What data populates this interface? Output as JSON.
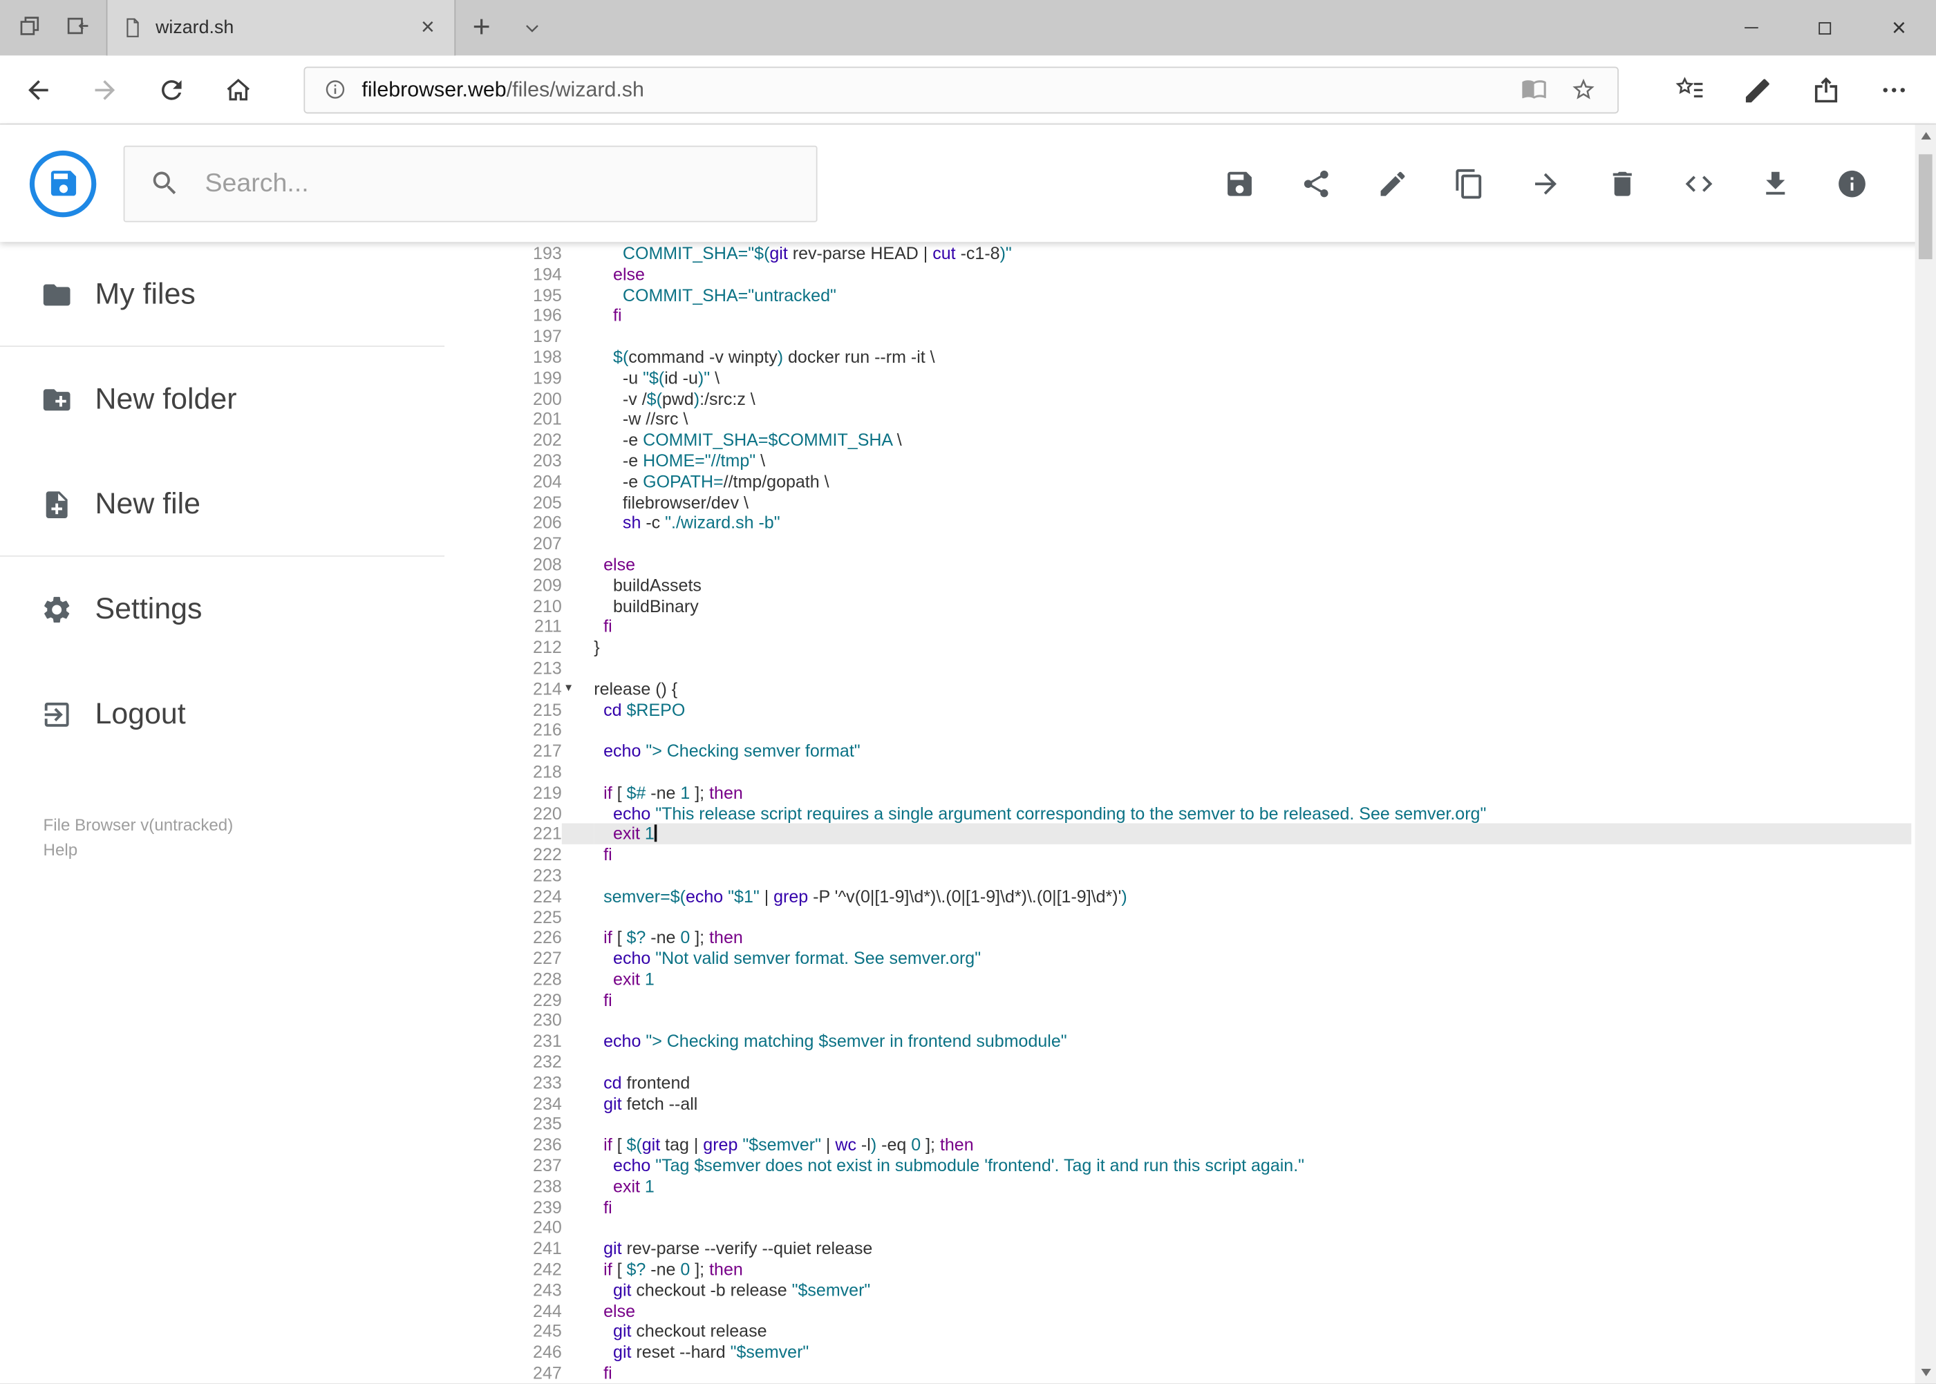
{
  "browser": {
    "tab_title": "wizard.sh",
    "url_domain": "filebrowser.web",
    "url_path": "/files/wizard.sh",
    "tab_icons": [
      "tabs-set-aside",
      "set-tabs-aside",
      "page",
      "tab-close",
      "new-tab",
      "tab-preview-chevron"
    ],
    "nav_icons": [
      "back",
      "forward",
      "refresh",
      "home"
    ],
    "address_icons": [
      "site-info",
      "reading-view",
      "favorite-star"
    ],
    "action_icons": [
      "hub",
      "web-note",
      "share",
      "more"
    ],
    "window_icons": [
      "minimize",
      "maximize",
      "close"
    ]
  },
  "header": {
    "search_placeholder": "Search...",
    "toolbar": [
      {
        "id": "save",
        "icon": "save"
      },
      {
        "id": "share",
        "icon": "share"
      },
      {
        "id": "edit",
        "icon": "pencil"
      },
      {
        "id": "copy",
        "icon": "copy"
      },
      {
        "id": "move",
        "icon": "move"
      },
      {
        "id": "delete",
        "icon": "trash"
      },
      {
        "id": "code",
        "icon": "code"
      },
      {
        "id": "download",
        "icon": "download"
      },
      {
        "id": "info",
        "icon": "info"
      }
    ]
  },
  "sidebar": {
    "items": [
      {
        "id": "my-files",
        "label": "My files",
        "icon": "folder",
        "divider_after": true
      },
      {
        "id": "new-folder",
        "label": "New folder",
        "icon": "folder-plus",
        "divider_after": false
      },
      {
        "id": "new-file",
        "label": "New file",
        "icon": "file-plus",
        "divider_after": true
      },
      {
        "id": "settings",
        "label": "Settings",
        "icon": "gear",
        "divider_after": false
      },
      {
        "id": "logout",
        "label": "Logout",
        "icon": "logout",
        "divider_after": false
      }
    ],
    "footer_version": "File Browser v(untracked)",
    "footer_help": "Help"
  },
  "editor": {
    "active_line": 221,
    "cursor_line": 221,
    "fold_lines": [
      214
    ],
    "palette": {
      "p": "#333333",
      "k": "#770088",
      "b": "#3300aa",
      "s": "#0b7285",
      "v": "#0b7285",
      "n": "#0b7285"
    },
    "lines": [
      {
        "n": 193,
        "s": [
          [
            "p",
            "      "
          ],
          [
            "v",
            "COMMIT_SHA="
          ],
          [
            "s",
            "\"$("
          ],
          [
            "b",
            "git"
          ],
          [
            "p",
            " rev-parse HEAD | "
          ],
          [
            "b",
            "cut"
          ],
          [
            "p",
            " -c1-8"
          ],
          [
            "s",
            ")\""
          ]
        ]
      },
      {
        "n": 194,
        "s": [
          [
            "p",
            "    "
          ],
          [
            "k",
            "else"
          ]
        ]
      },
      {
        "n": 195,
        "s": [
          [
            "p",
            "      "
          ],
          [
            "v",
            "COMMIT_SHA="
          ],
          [
            "s",
            "\"untracked\""
          ]
        ]
      },
      {
        "n": 196,
        "s": [
          [
            "p",
            "    "
          ],
          [
            "k",
            "fi"
          ]
        ]
      },
      {
        "n": 197,
        "s": []
      },
      {
        "n": 198,
        "s": [
          [
            "p",
            "    "
          ],
          [
            "v",
            "$("
          ],
          [
            "p",
            "command -v winpty"
          ],
          [
            "v",
            ")"
          ],
          [
            "p",
            " docker run --rm -it \\"
          ]
        ]
      },
      {
        "n": 199,
        "s": [
          [
            "p",
            "      -u "
          ],
          [
            "s",
            "\"$("
          ],
          [
            "p",
            "id -u"
          ],
          [
            "s",
            ")\""
          ],
          [
            "p",
            " \\"
          ]
        ]
      },
      {
        "n": 200,
        "s": [
          [
            "p",
            "      -v /"
          ],
          [
            "v",
            "$("
          ],
          [
            "p",
            "pwd"
          ],
          [
            "v",
            ")"
          ],
          [
            "p",
            ":/src:z \\"
          ]
        ]
      },
      {
        "n": 201,
        "s": [
          [
            "p",
            "      -w //src \\"
          ]
        ]
      },
      {
        "n": 202,
        "s": [
          [
            "p",
            "      -e "
          ],
          [
            "v",
            "COMMIT_SHA=$COMMIT_SHA"
          ],
          [
            "p",
            " \\"
          ]
        ]
      },
      {
        "n": 203,
        "s": [
          [
            "p",
            "      -e "
          ],
          [
            "v",
            "HOME="
          ],
          [
            "s",
            "\"//tmp\""
          ],
          [
            "p",
            " \\"
          ]
        ]
      },
      {
        "n": 204,
        "s": [
          [
            "p",
            "      -e "
          ],
          [
            "v",
            "GOPATH="
          ],
          [
            "p",
            "//tmp/gopath \\"
          ]
        ]
      },
      {
        "n": 205,
        "s": [
          [
            "p",
            "      filebrowser/dev \\"
          ]
        ]
      },
      {
        "n": 206,
        "s": [
          [
            "p",
            "      "
          ],
          [
            "b",
            "sh"
          ],
          [
            "p",
            " -c "
          ],
          [
            "s",
            "\"./wizard.sh -b\""
          ]
        ]
      },
      {
        "n": 207,
        "s": []
      },
      {
        "n": 208,
        "s": [
          [
            "p",
            "  "
          ],
          [
            "k",
            "else"
          ]
        ]
      },
      {
        "n": 209,
        "s": [
          [
            "p",
            "    buildAssets"
          ]
        ]
      },
      {
        "n": 210,
        "s": [
          [
            "p",
            "    buildBinary"
          ]
        ]
      },
      {
        "n": 211,
        "s": [
          [
            "p",
            "  "
          ],
          [
            "k",
            "fi"
          ]
        ]
      },
      {
        "n": 212,
        "s": [
          [
            "p",
            "}"
          ]
        ]
      },
      {
        "n": 213,
        "s": []
      },
      {
        "n": 214,
        "s": [
          [
            "p",
            "release () {"
          ]
        ]
      },
      {
        "n": 215,
        "s": [
          [
            "p",
            "  "
          ],
          [
            "b",
            "cd"
          ],
          [
            "p",
            " "
          ],
          [
            "v",
            "$REPO"
          ]
        ]
      },
      {
        "n": 216,
        "s": []
      },
      {
        "n": 217,
        "s": [
          [
            "p",
            "  "
          ],
          [
            "b",
            "echo"
          ],
          [
            "p",
            " "
          ],
          [
            "s",
            "\"> Checking semver format\""
          ]
        ]
      },
      {
        "n": 218,
        "s": []
      },
      {
        "n": 219,
        "s": [
          [
            "p",
            "  "
          ],
          [
            "k",
            "if"
          ],
          [
            "p",
            " [ "
          ],
          [
            "v",
            "$#"
          ],
          [
            "p",
            " -ne "
          ],
          [
            "n",
            "1"
          ],
          [
            "p",
            " ]; "
          ],
          [
            "k",
            "then"
          ]
        ]
      },
      {
        "n": 220,
        "s": [
          [
            "p",
            "    "
          ],
          [
            "b",
            "echo"
          ],
          [
            "p",
            " "
          ],
          [
            "s",
            "\"This release script requires a single argument corresponding to the semver to be released. See semver.org\""
          ]
        ]
      },
      {
        "n": 221,
        "s": [
          [
            "p",
            "    "
          ],
          [
            "k",
            "exit"
          ],
          [
            "p",
            " "
          ],
          [
            "n",
            "1"
          ]
        ]
      },
      {
        "n": 222,
        "s": [
          [
            "p",
            "  "
          ],
          [
            "k",
            "fi"
          ]
        ]
      },
      {
        "n": 223,
        "s": []
      },
      {
        "n": 224,
        "s": [
          [
            "p",
            "  "
          ],
          [
            "v",
            "semver=$("
          ],
          [
            "b",
            "echo"
          ],
          [
            "p",
            " "
          ],
          [
            "s",
            "\"$1\""
          ],
          [
            "p",
            " | "
          ],
          [
            "b",
            "grep"
          ],
          [
            "p",
            " -P '^v(0|[1-9]\\d*)\\.(0|[1-9]\\d*)\\.(0|[1-9]\\d*)'"
          ],
          [
            "v",
            ")"
          ]
        ]
      },
      {
        "n": 225,
        "s": []
      },
      {
        "n": 226,
        "s": [
          [
            "p",
            "  "
          ],
          [
            "k",
            "if"
          ],
          [
            "p",
            " [ "
          ],
          [
            "v",
            "$?"
          ],
          [
            "p",
            " -ne "
          ],
          [
            "n",
            "0"
          ],
          [
            "p",
            " ]; "
          ],
          [
            "k",
            "then"
          ]
        ]
      },
      {
        "n": 227,
        "s": [
          [
            "p",
            "    "
          ],
          [
            "b",
            "echo"
          ],
          [
            "p",
            " "
          ],
          [
            "s",
            "\"Not valid semver format. See semver.org\""
          ]
        ]
      },
      {
        "n": 228,
        "s": [
          [
            "p",
            "    "
          ],
          [
            "k",
            "exit"
          ],
          [
            "p",
            " "
          ],
          [
            "n",
            "1"
          ]
        ]
      },
      {
        "n": 229,
        "s": [
          [
            "p",
            "  "
          ],
          [
            "k",
            "fi"
          ]
        ]
      },
      {
        "n": 230,
        "s": []
      },
      {
        "n": 231,
        "s": [
          [
            "p",
            "  "
          ],
          [
            "b",
            "echo"
          ],
          [
            "p",
            " "
          ],
          [
            "s",
            "\"> Checking matching "
          ],
          [
            "v",
            "$semver"
          ],
          [
            "s",
            " in frontend submodule\""
          ]
        ]
      },
      {
        "n": 232,
        "s": []
      },
      {
        "n": 233,
        "s": [
          [
            "p",
            "  "
          ],
          [
            "b",
            "cd"
          ],
          [
            "p",
            " frontend"
          ]
        ]
      },
      {
        "n": 234,
        "s": [
          [
            "p",
            "  "
          ],
          [
            "b",
            "git"
          ],
          [
            "p",
            " fetch --all"
          ]
        ]
      },
      {
        "n": 235,
        "s": []
      },
      {
        "n": 236,
        "s": [
          [
            "p",
            "  "
          ],
          [
            "k",
            "if"
          ],
          [
            "p",
            " [ "
          ],
          [
            "v",
            "$("
          ],
          [
            "b",
            "git"
          ],
          [
            "p",
            " tag | "
          ],
          [
            "b",
            "grep"
          ],
          [
            "p",
            " "
          ],
          [
            "s",
            "\"$semver\""
          ],
          [
            "p",
            " | "
          ],
          [
            "b",
            "wc"
          ],
          [
            "p",
            " -l"
          ],
          [
            "v",
            ")"
          ],
          [
            "p",
            " -eq "
          ],
          [
            "n",
            "0"
          ],
          [
            "p",
            " ]; "
          ],
          [
            "k",
            "then"
          ]
        ]
      },
      {
        "n": 237,
        "s": [
          [
            "p",
            "    "
          ],
          [
            "b",
            "echo"
          ],
          [
            "p",
            " "
          ],
          [
            "s",
            "\"Tag "
          ],
          [
            "v",
            "$semver"
          ],
          [
            "s",
            " does not exist in submodule 'frontend'. Tag it and run this script again.\""
          ]
        ]
      },
      {
        "n": 238,
        "s": [
          [
            "p",
            "    "
          ],
          [
            "k",
            "exit"
          ],
          [
            "p",
            " "
          ],
          [
            "n",
            "1"
          ]
        ]
      },
      {
        "n": 239,
        "s": [
          [
            "p",
            "  "
          ],
          [
            "k",
            "fi"
          ]
        ]
      },
      {
        "n": 240,
        "s": []
      },
      {
        "n": 241,
        "s": [
          [
            "p",
            "  "
          ],
          [
            "b",
            "git"
          ],
          [
            "p",
            " rev-parse --verify --quiet release"
          ]
        ]
      },
      {
        "n": 242,
        "s": [
          [
            "p",
            "  "
          ],
          [
            "k",
            "if"
          ],
          [
            "p",
            " [ "
          ],
          [
            "v",
            "$?"
          ],
          [
            "p",
            " -ne "
          ],
          [
            "n",
            "0"
          ],
          [
            "p",
            " ]; "
          ],
          [
            "k",
            "then"
          ]
        ]
      },
      {
        "n": 243,
        "s": [
          [
            "p",
            "    "
          ],
          [
            "b",
            "git"
          ],
          [
            "p",
            " checkout -b release "
          ],
          [
            "s",
            "\"$semver\""
          ]
        ]
      },
      {
        "n": 244,
        "s": [
          [
            "p",
            "  "
          ],
          [
            "k",
            "else"
          ]
        ]
      },
      {
        "n": 245,
        "s": [
          [
            "p",
            "    "
          ],
          [
            "b",
            "git"
          ],
          [
            "p",
            " checkout release"
          ]
        ]
      },
      {
        "n": 246,
        "s": [
          [
            "p",
            "    "
          ],
          [
            "b",
            "git"
          ],
          [
            "p",
            " reset --hard "
          ],
          [
            "s",
            "\"$semver\""
          ]
        ]
      },
      {
        "n": 247,
        "s": [
          [
            "p",
            "  "
          ],
          [
            "k",
            "fi"
          ]
        ]
      }
    ]
  }
}
